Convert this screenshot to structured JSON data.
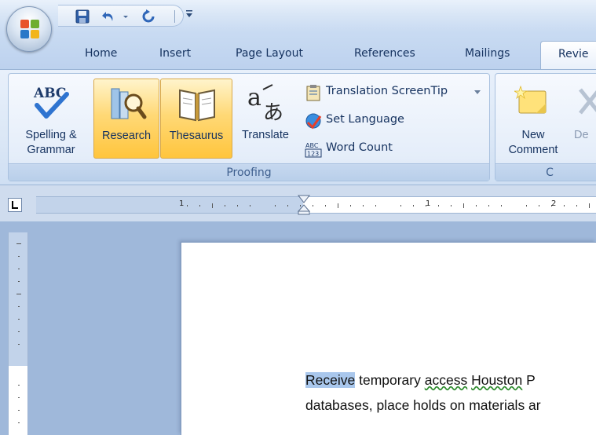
{
  "quick_access": {
    "icons": [
      "save-icon",
      "undo-icon",
      "redo-icon",
      "customize-dropdown-icon"
    ]
  },
  "tabs": [
    {
      "label": "Home"
    },
    {
      "label": "Insert"
    },
    {
      "label": "Page Layout"
    },
    {
      "label": "References"
    },
    {
      "label": "Mailings"
    },
    {
      "label": "Revie"
    }
  ],
  "ribbon": {
    "proofing": {
      "group_label": "Proofing",
      "spelling_line1": "Spelling &",
      "spelling_line2": "Grammar",
      "research": "Research",
      "thesaurus": "Thesaurus",
      "translate": "Translate",
      "translation_screentip": "Translation ScreenTip",
      "set_language": "Set Language",
      "word_count": "Word Count",
      "abc_icon_text": "ABC",
      "wordcount_icon_text": "ABC\n123"
    },
    "comments": {
      "group_label": "C",
      "new_line1": "New",
      "new_line2": "Comment",
      "delete_partial": "De"
    }
  },
  "ruler": {
    "numbers": [
      "1",
      "1",
      "2"
    ]
  },
  "document": {
    "line1_selected": "Receive",
    "line1_a": " temporary ",
    "line1_b": "access",
    "line1_c": "  ",
    "line1_d": "Houston",
    "line1_e": " P",
    "line2": "databases, place holds on materials ar"
  },
  "colors": {
    "highlight_button": "#ffc53d",
    "selection": "#a9c7ec",
    "tab_text": "#15325f"
  }
}
